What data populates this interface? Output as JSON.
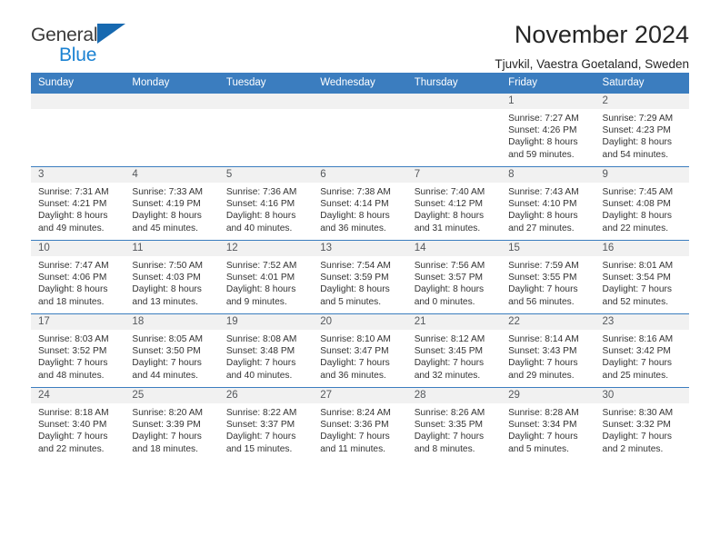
{
  "brand": {
    "name_top": "General",
    "name_bottom": "Blue",
    "accent_color": "#1b82d2",
    "triangle_color": "#1769b0"
  },
  "header": {
    "title": "November 2024",
    "subtitle": "Tjuvkil, Vaestra Goetaland, Sweden"
  },
  "calendar": {
    "header_bg": "#3b7dbf",
    "daynum_bg": "#f1f1f1",
    "weekday_headers": [
      "Sunday",
      "Monday",
      "Tuesday",
      "Wednesday",
      "Thursday",
      "Friday",
      "Saturday"
    ],
    "weeks": [
      [
        {
          "day": "",
          "sunrise": "",
          "sunset": "",
          "daylight_1": "",
          "daylight_2": ""
        },
        {
          "day": "",
          "sunrise": "",
          "sunset": "",
          "daylight_1": "",
          "daylight_2": ""
        },
        {
          "day": "",
          "sunrise": "",
          "sunset": "",
          "daylight_1": "",
          "daylight_2": ""
        },
        {
          "day": "",
          "sunrise": "",
          "sunset": "",
          "daylight_1": "",
          "daylight_2": ""
        },
        {
          "day": "",
          "sunrise": "",
          "sunset": "",
          "daylight_1": "",
          "daylight_2": ""
        },
        {
          "day": "1",
          "sunrise": "Sunrise: 7:27 AM",
          "sunset": "Sunset: 4:26 PM",
          "daylight_1": "Daylight: 8 hours",
          "daylight_2": "and 59 minutes."
        },
        {
          "day": "2",
          "sunrise": "Sunrise: 7:29 AM",
          "sunset": "Sunset: 4:23 PM",
          "daylight_1": "Daylight: 8 hours",
          "daylight_2": "and 54 minutes."
        }
      ],
      [
        {
          "day": "3",
          "sunrise": "Sunrise: 7:31 AM",
          "sunset": "Sunset: 4:21 PM",
          "daylight_1": "Daylight: 8 hours",
          "daylight_2": "and 49 minutes."
        },
        {
          "day": "4",
          "sunrise": "Sunrise: 7:33 AM",
          "sunset": "Sunset: 4:19 PM",
          "daylight_1": "Daylight: 8 hours",
          "daylight_2": "and 45 minutes."
        },
        {
          "day": "5",
          "sunrise": "Sunrise: 7:36 AM",
          "sunset": "Sunset: 4:16 PM",
          "daylight_1": "Daylight: 8 hours",
          "daylight_2": "and 40 minutes."
        },
        {
          "day": "6",
          "sunrise": "Sunrise: 7:38 AM",
          "sunset": "Sunset: 4:14 PM",
          "daylight_1": "Daylight: 8 hours",
          "daylight_2": "and 36 minutes."
        },
        {
          "day": "7",
          "sunrise": "Sunrise: 7:40 AM",
          "sunset": "Sunset: 4:12 PM",
          "daylight_1": "Daylight: 8 hours",
          "daylight_2": "and 31 minutes."
        },
        {
          "day": "8",
          "sunrise": "Sunrise: 7:43 AM",
          "sunset": "Sunset: 4:10 PM",
          "daylight_1": "Daylight: 8 hours",
          "daylight_2": "and 27 minutes."
        },
        {
          "day": "9",
          "sunrise": "Sunrise: 7:45 AM",
          "sunset": "Sunset: 4:08 PM",
          "daylight_1": "Daylight: 8 hours",
          "daylight_2": "and 22 minutes."
        }
      ],
      [
        {
          "day": "10",
          "sunrise": "Sunrise: 7:47 AM",
          "sunset": "Sunset: 4:06 PM",
          "daylight_1": "Daylight: 8 hours",
          "daylight_2": "and 18 minutes."
        },
        {
          "day": "11",
          "sunrise": "Sunrise: 7:50 AM",
          "sunset": "Sunset: 4:03 PM",
          "daylight_1": "Daylight: 8 hours",
          "daylight_2": "and 13 minutes."
        },
        {
          "day": "12",
          "sunrise": "Sunrise: 7:52 AM",
          "sunset": "Sunset: 4:01 PM",
          "daylight_1": "Daylight: 8 hours",
          "daylight_2": "and 9 minutes."
        },
        {
          "day": "13",
          "sunrise": "Sunrise: 7:54 AM",
          "sunset": "Sunset: 3:59 PM",
          "daylight_1": "Daylight: 8 hours",
          "daylight_2": "and 5 minutes."
        },
        {
          "day": "14",
          "sunrise": "Sunrise: 7:56 AM",
          "sunset": "Sunset: 3:57 PM",
          "daylight_1": "Daylight: 8 hours",
          "daylight_2": "and 0 minutes."
        },
        {
          "day": "15",
          "sunrise": "Sunrise: 7:59 AM",
          "sunset": "Sunset: 3:55 PM",
          "daylight_1": "Daylight: 7 hours",
          "daylight_2": "and 56 minutes."
        },
        {
          "day": "16",
          "sunrise": "Sunrise: 8:01 AM",
          "sunset": "Sunset: 3:54 PM",
          "daylight_1": "Daylight: 7 hours",
          "daylight_2": "and 52 minutes."
        }
      ],
      [
        {
          "day": "17",
          "sunrise": "Sunrise: 8:03 AM",
          "sunset": "Sunset: 3:52 PM",
          "daylight_1": "Daylight: 7 hours",
          "daylight_2": "and 48 minutes."
        },
        {
          "day": "18",
          "sunrise": "Sunrise: 8:05 AM",
          "sunset": "Sunset: 3:50 PM",
          "daylight_1": "Daylight: 7 hours",
          "daylight_2": "and 44 minutes."
        },
        {
          "day": "19",
          "sunrise": "Sunrise: 8:08 AM",
          "sunset": "Sunset: 3:48 PM",
          "daylight_1": "Daylight: 7 hours",
          "daylight_2": "and 40 minutes."
        },
        {
          "day": "20",
          "sunrise": "Sunrise: 8:10 AM",
          "sunset": "Sunset: 3:47 PM",
          "daylight_1": "Daylight: 7 hours",
          "daylight_2": "and 36 minutes."
        },
        {
          "day": "21",
          "sunrise": "Sunrise: 8:12 AM",
          "sunset": "Sunset: 3:45 PM",
          "daylight_1": "Daylight: 7 hours",
          "daylight_2": "and 32 minutes."
        },
        {
          "day": "22",
          "sunrise": "Sunrise: 8:14 AM",
          "sunset": "Sunset: 3:43 PM",
          "daylight_1": "Daylight: 7 hours",
          "daylight_2": "and 29 minutes."
        },
        {
          "day": "23",
          "sunrise": "Sunrise: 8:16 AM",
          "sunset": "Sunset: 3:42 PM",
          "daylight_1": "Daylight: 7 hours",
          "daylight_2": "and 25 minutes."
        }
      ],
      [
        {
          "day": "24",
          "sunrise": "Sunrise: 8:18 AM",
          "sunset": "Sunset: 3:40 PM",
          "daylight_1": "Daylight: 7 hours",
          "daylight_2": "and 22 minutes."
        },
        {
          "day": "25",
          "sunrise": "Sunrise: 8:20 AM",
          "sunset": "Sunset: 3:39 PM",
          "daylight_1": "Daylight: 7 hours",
          "daylight_2": "and 18 minutes."
        },
        {
          "day": "26",
          "sunrise": "Sunrise: 8:22 AM",
          "sunset": "Sunset: 3:37 PM",
          "daylight_1": "Daylight: 7 hours",
          "daylight_2": "and 15 minutes."
        },
        {
          "day": "27",
          "sunrise": "Sunrise: 8:24 AM",
          "sunset": "Sunset: 3:36 PM",
          "daylight_1": "Daylight: 7 hours",
          "daylight_2": "and 11 minutes."
        },
        {
          "day": "28",
          "sunrise": "Sunrise: 8:26 AM",
          "sunset": "Sunset: 3:35 PM",
          "daylight_1": "Daylight: 7 hours",
          "daylight_2": "and 8 minutes."
        },
        {
          "day": "29",
          "sunrise": "Sunrise: 8:28 AM",
          "sunset": "Sunset: 3:34 PM",
          "daylight_1": "Daylight: 7 hours",
          "daylight_2": "and 5 minutes."
        },
        {
          "day": "30",
          "sunrise": "Sunrise: 8:30 AM",
          "sunset": "Sunset: 3:32 PM",
          "daylight_1": "Daylight: 7 hours",
          "daylight_2": "and 2 minutes."
        }
      ]
    ]
  }
}
